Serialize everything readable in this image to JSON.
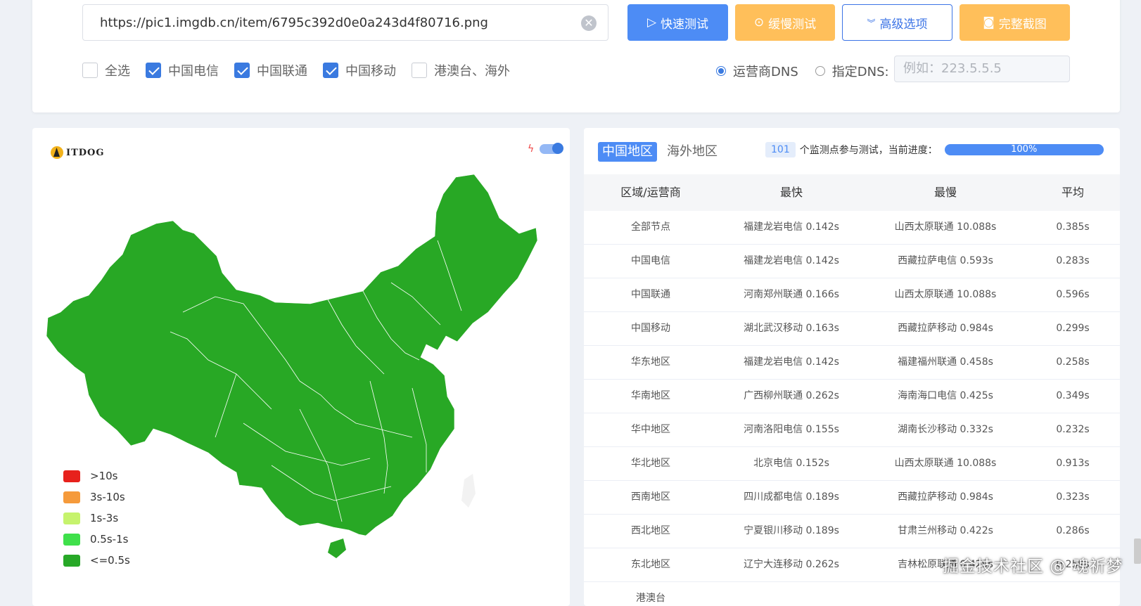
{
  "search": {
    "url_value": "https://pic1.imgdb.cn/item/6795c392d0e0a243d4f80716.png"
  },
  "buttons": {
    "quick": "快速测试",
    "slow": "缓慢测试",
    "advanced": "高级选项",
    "screenshot": "完整截图"
  },
  "checkboxes": [
    {
      "label": "全选",
      "checked": false
    },
    {
      "label": "中国电信",
      "checked": true
    },
    {
      "label": "中国联通",
      "checked": true
    },
    {
      "label": "中国移动",
      "checked": true
    },
    {
      "label": "港澳台、海外",
      "checked": false
    }
  ],
  "dns": {
    "option1": "运营商DNS",
    "option2": "指定DNS:",
    "placeholder": "例如：223.5.5.5"
  },
  "map": {
    "logo_text": "ITDOG",
    "fill_color": "#28a825",
    "legend": [
      {
        "label": ">10s",
        "color": "#e7211c"
      },
      {
        "label": "3s-10s",
        "color": "#f59a3b"
      },
      {
        "label": "1s-3s",
        "color": "#c6f36d"
      },
      {
        "label": "0.5s-1s",
        "color": "#3fe04b"
      },
      {
        "label": "<=0.5s",
        "color": "#27a827"
      }
    ]
  },
  "results": {
    "tabs": [
      "中国地区",
      "海外地区"
    ],
    "monitor_count": "101",
    "progress_text": "个监测点参与测试，当前进度：",
    "progress_value": "100%",
    "headers": [
      "区域/运营商",
      "最快",
      "最慢",
      "平均"
    ],
    "rows": [
      [
        "全部节点",
        "福建龙岩电信 0.142s",
        "山西太原联通 10.088s",
        "0.385s"
      ],
      [
        "中国电信",
        "福建龙岩电信 0.142s",
        "西藏拉萨电信 0.593s",
        "0.283s"
      ],
      [
        "中国联通",
        "河南郑州联通 0.166s",
        "山西太原联通 10.088s",
        "0.596s"
      ],
      [
        "中国移动",
        "湖北武汉移动 0.163s",
        "西藏拉萨移动 0.984s",
        "0.299s"
      ],
      [
        "华东地区",
        "福建龙岩电信 0.142s",
        "福建福州联通 0.458s",
        "0.258s"
      ],
      [
        "华南地区",
        "广西柳州联通 0.262s",
        "海南海口电信 0.425s",
        "0.349s"
      ],
      [
        "华中地区",
        "河南洛阳电信 0.155s",
        "湖南长沙移动 0.332s",
        "0.232s"
      ],
      [
        "华北地区",
        "北京电信 0.152s",
        "山西太原联通 10.088s",
        "0.913s"
      ],
      [
        "西南地区",
        "四川成都电信 0.189s",
        "西藏拉萨移动 0.984s",
        "0.323s"
      ],
      [
        "西北地区",
        "宁夏银川移动 0.189s",
        "甘肃兰州移动 0.422s",
        "0.286s"
      ],
      [
        "东北地区",
        "辽宁大连移动 0.262s",
        "吉林松原联通 0.429s",
        "0.259s"
      ],
      [
        "港澳台",
        "",
        "",
        ""
      ]
    ]
  },
  "watermark": "掘金技术社区 @ 魂祈梦"
}
